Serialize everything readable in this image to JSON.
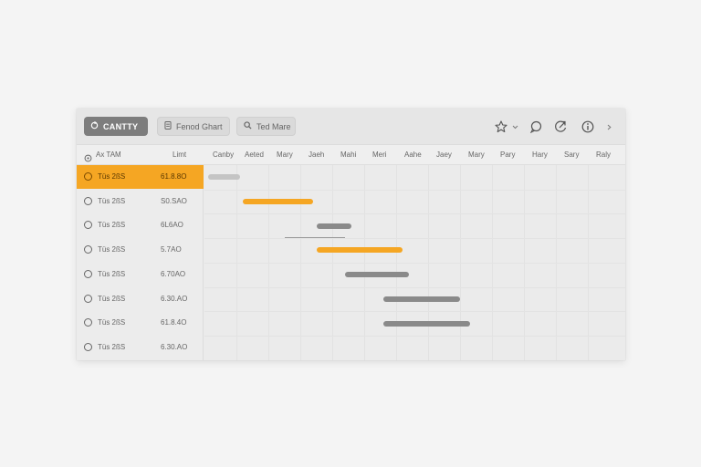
{
  "toolbar": {
    "primary_label": "CANTTY",
    "chart_label": "Fenod Ghart",
    "find_label": "Ted Mare"
  },
  "header": {
    "col_name": "Ax TAM",
    "col_value": "Limt",
    "timeline": [
      "Canby",
      "Aeted",
      "Mary",
      "Jaeh",
      "Mahi",
      "Meri",
      "Aahe",
      "Jaey",
      "Mary",
      "Pary",
      "Hary",
      "Sary",
      "Raly"
    ]
  },
  "rows": [
    {
      "name": "Tüs 2ßS",
      "value": "61.8.8O",
      "selected": true
    },
    {
      "name": "Tüs 2ßS",
      "value": "S0.SAO",
      "selected": false
    },
    {
      "name": "Tüs 2ßS",
      "value": "6L6AO",
      "selected": false
    },
    {
      "name": "Tüs 2ßS",
      "value": "5.7AO",
      "selected": false
    },
    {
      "name": "Tüs 2ßS",
      "value": "6.70AO",
      "selected": false
    },
    {
      "name": "Tüs 2ßS",
      "value": "6.30.AO",
      "selected": false
    },
    {
      "name": "Tüs 2ßS",
      "value": "61.8.4O",
      "selected": false
    },
    {
      "name": "Tüs 2ßS",
      "value": "6.30.AO",
      "selected": false
    }
  ],
  "tasks": [
    {
      "row": 0,
      "start": 0.1,
      "end": 1.1,
      "color": "light"
    },
    {
      "row": 1,
      "start": 1.2,
      "end": 3.4,
      "color": "orange"
    },
    {
      "row": 2,
      "start": 3.5,
      "end": 4.6,
      "color": "gray"
    },
    {
      "row": 3,
      "start": 3.5,
      "end": 6.2,
      "color": "orange"
    },
    {
      "row": 4,
      "start": 4.4,
      "end": 6.4,
      "color": "gray"
    },
    {
      "row": 5,
      "start": 5.6,
      "end": 8.0,
      "color": "gray"
    },
    {
      "row": 6,
      "start": 5.6,
      "end": 8.3,
      "color": "gray"
    }
  ],
  "connectors": [
    {
      "row": 2,
      "start": 2.5,
      "end": 4.4
    }
  ],
  "colors": {
    "accent": "#f5a623",
    "bar_gray": "#8a8a8a",
    "bar_light": "#c4c4c4"
  },
  "icons": {
    "primary": "refresh-icon",
    "chart": "document-icon",
    "find": "search-icon",
    "right": [
      "star-icon",
      "chevron-down-icon",
      "comment-icon",
      "share-icon",
      "info-icon",
      "chevron-right-icon"
    ]
  }
}
